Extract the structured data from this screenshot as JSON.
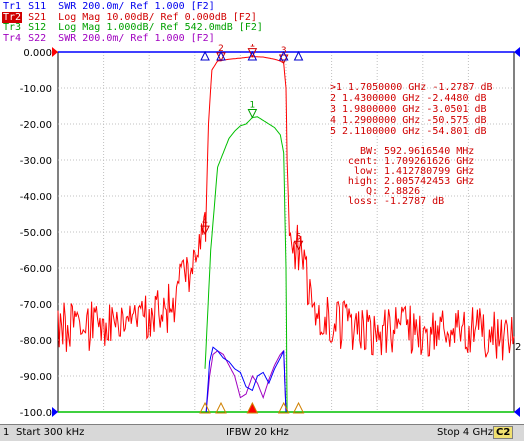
{
  "traces": [
    {
      "id": "Tr1",
      "text": " S11  SWR 200.0m/ Ref 1.000 [F2]",
      "color": "#0000ee",
      "active": false
    },
    {
      "id": "Tr2",
      "text": " S21  Log Mag 10.00dB/ Ref 0.000dB [F2]",
      "color": "#d00000",
      "active": true
    },
    {
      "id": "Tr3",
      "text": " S12  Log Mag 1.000dB/ Ref 542.0mdB [F2]",
      "color": "#00a000",
      "active": false
    },
    {
      "id": "Tr4",
      "text": " S22  SWR 200.0m/ Ref 1.000 [F2]",
      "color": "#a000c0",
      "active": false
    }
  ],
  "footer": {
    "channel_num": "1",
    "start": "Start 300 kHz",
    "ifbw": "IFBW 20 kHz",
    "stop": "Stop 4 GHz",
    "channel_tag": "C2"
  },
  "chart_data": {
    "type": "line",
    "x_range_ghz": [
      0.0003,
      4.0
    ],
    "ylim": [
      -100,
      0
    ],
    "y_ticks": [
      0,
      -10,
      -20,
      -30,
      -40,
      -50,
      -60,
      -70,
      -80,
      -90,
      -100
    ],
    "y_tick_labels": [
      "0.000",
      "-10.00",
      "-20.00",
      "-30.00",
      "-40.00",
      "-50.00",
      "-60.00",
      "-70.00",
      "-80.00",
      "-90.00",
      "-100.0"
    ],
    "grid": true,
    "series": [
      {
        "name": "S21",
        "color": "#ff0000",
        "x": [
          0.0003,
          0.2,
          0.4,
          0.6,
          0.8,
          0.95,
          1.0,
          1.05,
          1.1,
          1.15,
          1.2,
          1.25,
          1.27,
          1.29,
          1.3,
          1.32,
          1.35,
          1.4,
          1.43,
          1.5,
          1.6,
          1.705,
          1.8,
          1.9,
          1.95,
          1.98,
          2.0,
          2.01,
          2.03,
          2.05,
          2.08,
          2.11,
          2.15,
          2.2,
          2.3,
          2.5,
          2.7,
          2.9,
          3.1,
          3.3,
          3.5,
          3.7,
          3.9,
          4.0
        ],
        "y": [
          -76,
          -77,
          -75,
          -76,
          -74,
          -72,
          -70,
          -67,
          -64,
          -62,
          -58,
          -52,
          -48,
          -50.6,
          -44,
          -20,
          -5,
          -2.5,
          -2.4,
          -2,
          -1.7,
          -1.3,
          -1.4,
          -2,
          -2.5,
          -3.1,
          -10,
          -30,
          -50,
          -54,
          -54.8,
          -54.8,
          -60,
          -65,
          -72,
          -76,
          -77,
          -78,
          -77,
          -78,
          -77,
          -78,
          -79,
          -79
        ]
      },
      {
        "name": "S12",
        "color": "#00c000",
        "x": [
          1.29,
          1.34,
          1.4,
          1.45,
          1.5,
          1.55,
          1.6,
          1.65,
          1.705,
          1.75,
          1.8,
          1.85,
          1.9,
          1.95,
          1.98,
          2.0,
          2.01
        ],
        "y": [
          -88,
          -55,
          -32,
          -28,
          -24,
          -22,
          -20.5,
          -20,
          -18.2,
          -18,
          -19,
          -20,
          -21,
          -23,
          -28,
          -60,
          -100
        ]
      },
      {
        "name": "S11",
        "color": "#0000ff",
        "x": [
          1.3,
          1.33,
          1.36,
          1.4,
          1.45,
          1.5,
          1.55,
          1.6,
          1.65,
          1.705,
          1.75,
          1.8,
          1.85,
          1.9,
          1.95,
          1.98,
          2.0
        ],
        "y": [
          -100,
          -86,
          -82,
          -83,
          -85,
          -86,
          -88,
          -89,
          -93,
          -94,
          -90,
          -89,
          -92,
          -88,
          -85,
          -83,
          -100
        ]
      },
      {
        "name": "S22",
        "color": "#a000c0",
        "x": [
          1.3,
          1.33,
          1.36,
          1.4,
          1.45,
          1.5,
          1.55,
          1.6,
          1.65,
          1.705,
          1.75,
          1.8,
          1.85,
          1.9,
          1.95,
          1.98,
          2.0
        ],
        "y": [
          -100,
          -90,
          -84,
          -83,
          -84,
          -87,
          -90,
          -96,
          -95,
          -90,
          -92,
          -96,
          -91,
          -87,
          -84,
          -83,
          -100
        ]
      }
    ],
    "markers": [
      {
        "num": "1",
        "x": 1.705,
        "y": -1.2787,
        "line": ">1",
        "freq": "1.7050000 GHz",
        "val": "-1.2787 dB"
      },
      {
        "num": "2",
        "x": 1.43,
        "y": -2.448,
        "line": " 2",
        "freq": "1.4300000 GHz",
        "val": "-2.4480 dB"
      },
      {
        "num": "3",
        "x": 1.98,
        "y": -3.0501,
        "line": " 3",
        "freq": "1.9800000 GHz",
        "val": "-3.0501 dB"
      },
      {
        "num": "4",
        "x": 1.29,
        "y": -50.575,
        "line": " 4",
        "freq": "1.2900000 GHz",
        "val": "-50.575 dB"
      },
      {
        "num": "5",
        "x": 2.11,
        "y": -54.801,
        "line": " 5",
        "freq": "2.1100000 GHz",
        "val": "-54.801 dB"
      }
    ],
    "bw_stats": [
      {
        "label": "BW:",
        "value": "592.9616540 MHz"
      },
      {
        "label": "cent:",
        "value": "1.709261626 GHz"
      },
      {
        "label": "low:",
        "value": "1.412780799 GHz"
      },
      {
        "label": "high:",
        "value": "2.005742453 GHz"
      },
      {
        "label": "Q:",
        "value": "2.8826"
      },
      {
        "label": "loss:",
        "value": "-1.2787 dB"
      }
    ],
    "ref_label_right": "2"
  }
}
